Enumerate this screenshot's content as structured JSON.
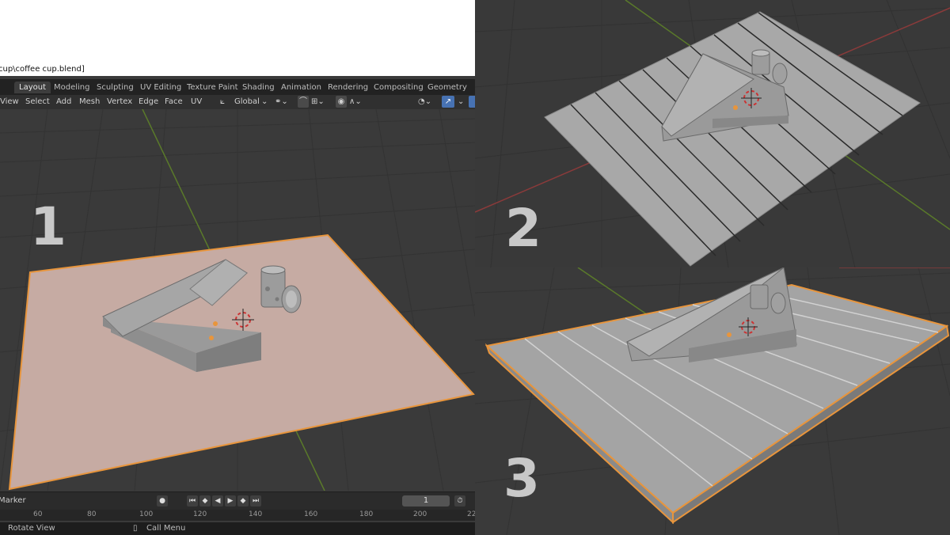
{
  "window": {
    "file_path": "cup\\coffee cup.blend]"
  },
  "workspaces": [
    "Layout",
    "Modeling",
    "Sculpting",
    "UV Editing",
    "Texture Paint",
    "Shading",
    "Animation",
    "Rendering",
    "Compositing",
    "Geometry Nod"
  ],
  "active_workspace": "Layout",
  "header_menus": [
    "View",
    "Select",
    "Add",
    "Mesh",
    "Vertex",
    "Edge",
    "Face",
    "UV"
  ],
  "transform_orientation": "Global",
  "panel_labels": [
    "1",
    "2",
    "3"
  ],
  "timeline": {
    "marker_label": "Marker",
    "current_frame": "1"
  },
  "ruler_ticks": [
    "60",
    "80",
    "100",
    "120",
    "140",
    "160",
    "180",
    "200",
    "22"
  ],
  "statusbar": {
    "rotate_view": "Rotate View",
    "call_menu": "Call Menu"
  },
  "colors": {
    "selection_orange": "#e8953c",
    "grid_red": "#8a3a3a",
    "grid_green": "#5a7a2a",
    "plane_selected": "#c6aba3",
    "mesh_grey": "#a8a8a8"
  }
}
